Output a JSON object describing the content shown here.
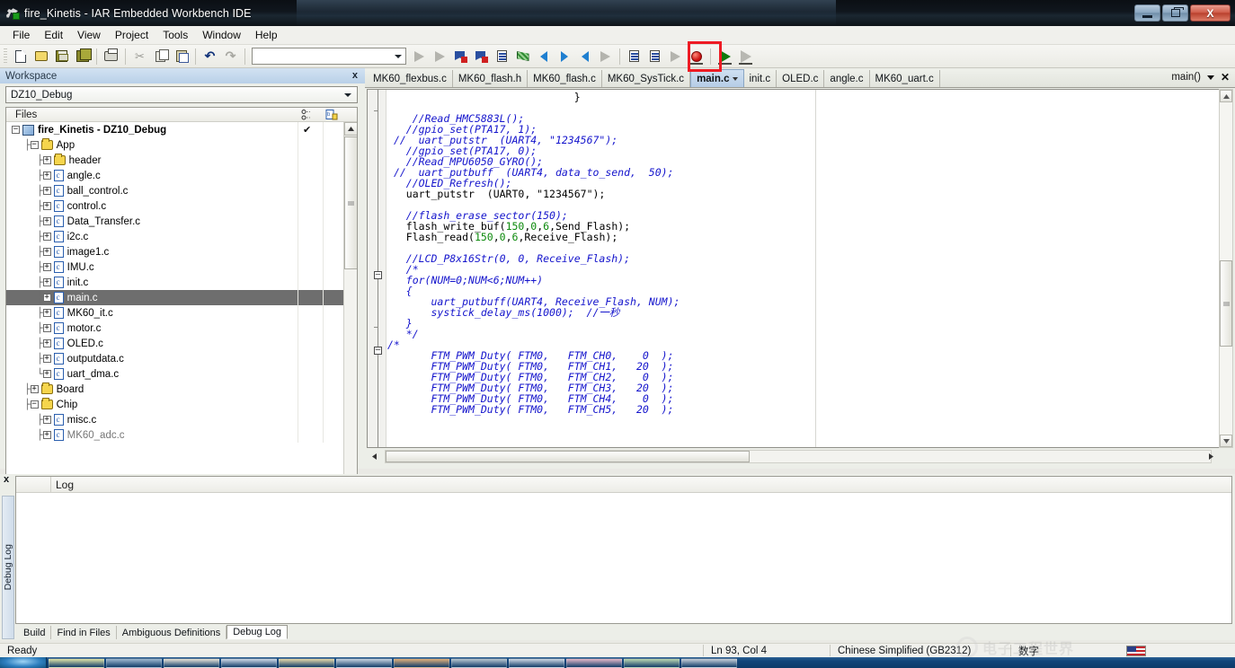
{
  "window": {
    "title": "fire_Kinetis - IAR Embedded Workbench IDE",
    "app_icon": "iar-workbench-icon",
    "buttons": {
      "minimize": "minimize-button",
      "maximize": "maximize-button",
      "close": "X"
    }
  },
  "menu": {
    "items": [
      "File",
      "Edit",
      "View",
      "Project",
      "Tools",
      "Window",
      "Help"
    ]
  },
  "toolbar": {
    "combo_value": "",
    "icons": [
      "new-document-icon",
      "open-folder-icon",
      "save-icon",
      "save-all-icon",
      "print-icon",
      "cut-icon",
      "copy-icon",
      "paste-icon",
      "undo-icon",
      "redo-icon",
      "toggle-bookmark-icon",
      "navigate-bookmark-icon",
      "find-icon",
      "find-next-icon",
      "compile-icon",
      "make-icon",
      "go-back-icon",
      "go-forward-icon",
      "navigate-backward-icon",
      "navigate-forward-icon",
      "stop-build-icon",
      "debug-without-download-icon",
      "toggle-breakpoint-icon",
      "download-and-debug-icon",
      "run-icon"
    ],
    "highlight_color": "#ee1b24",
    "highlighted_button": "download-and-debug-button"
  },
  "workspace": {
    "title": "Workspace",
    "close_label": "x",
    "config_selected": "DZ10_Debug",
    "files_column_header": "Files",
    "tab_label": "fire_Kinetis",
    "tree": [
      {
        "label": "fire_Kinetis - DZ10_Debug",
        "depth": 0,
        "icon": "project-icon",
        "expander": "minus",
        "bold": true,
        "checked": true
      },
      {
        "label": "App",
        "depth": 1,
        "icon": "folder-icon",
        "expander": "minus"
      },
      {
        "label": "header",
        "depth": 2,
        "icon": "folder-icon",
        "expander": "plus"
      },
      {
        "label": "angle.c",
        "depth": 2,
        "icon": "c-file-icon",
        "expander": "plus"
      },
      {
        "label": "ball_control.c",
        "depth": 2,
        "icon": "c-file-icon",
        "expander": "plus"
      },
      {
        "label": "control.c",
        "depth": 2,
        "icon": "c-file-icon",
        "expander": "plus"
      },
      {
        "label": "Data_Transfer.c",
        "depth": 2,
        "icon": "c-file-icon",
        "expander": "plus"
      },
      {
        "label": "i2c.c",
        "depth": 2,
        "icon": "c-file-icon",
        "expander": "plus"
      },
      {
        "label": "image1.c",
        "depth": 2,
        "icon": "c-file-icon",
        "expander": "plus"
      },
      {
        "label": "IMU.c",
        "depth": 2,
        "icon": "c-file-icon",
        "expander": "plus"
      },
      {
        "label": "init.c",
        "depth": 2,
        "icon": "c-file-icon",
        "expander": "plus"
      },
      {
        "label": "main.c",
        "depth": 2,
        "icon": "c-file-icon",
        "expander": "plus",
        "selected": true
      },
      {
        "label": "MK60_it.c",
        "depth": 2,
        "icon": "c-file-icon",
        "expander": "plus"
      },
      {
        "label": "motor.c",
        "depth": 2,
        "icon": "c-file-icon",
        "expander": "plus"
      },
      {
        "label": "OLED.c",
        "depth": 2,
        "icon": "c-file-icon",
        "expander": "plus"
      },
      {
        "label": "outputdata.c",
        "depth": 2,
        "icon": "c-file-icon",
        "expander": "plus"
      },
      {
        "label": "uart_dma.c",
        "depth": 2,
        "icon": "c-file-icon",
        "expander": "plus",
        "last": true
      },
      {
        "label": "Board",
        "depth": 1,
        "icon": "folder-icon",
        "expander": "plus"
      },
      {
        "label": "Chip",
        "depth": 1,
        "icon": "folder-icon",
        "expander": "minus"
      },
      {
        "label": "misc.c",
        "depth": 2,
        "icon": "c-file-icon",
        "expander": "plus"
      },
      {
        "label": "MK60_adc.c",
        "depth": 2,
        "icon": "c-file-icon",
        "expander": "plus",
        "clipped": true
      }
    ]
  },
  "editor": {
    "tabs": [
      {
        "label": "MK60_flexbus.c",
        "active": false
      },
      {
        "label": "MK60_flash.h",
        "active": false
      },
      {
        "label": "MK60_flash.c",
        "active": false
      },
      {
        "label": "MK60_SysTick.c",
        "active": false
      },
      {
        "label": "main.c",
        "active": true
      },
      {
        "label": "init.c",
        "active": false
      },
      {
        "label": "OLED.c",
        "active": false
      },
      {
        "label": "angle.c",
        "active": false
      },
      {
        "label": "MK60_uart.c",
        "active": false
      }
    ],
    "function_selector": "main()",
    "close_label": "✕",
    "lines": [
      {
        "indent": 30,
        "spans": [
          {
            "t": "}",
            "c": "plain"
          }
        ]
      },
      {
        "indent": 0,
        "spans": []
      },
      {
        "indent": 4,
        "spans": [
          {
            "t": "//Read_HMC5883L();",
            "c": "cmt"
          }
        ]
      },
      {
        "indent": 3,
        "spans": [
          {
            "t": "//gpio_set(PTA17, 1);",
            "c": "cmt"
          }
        ]
      },
      {
        "indent": 1,
        "spans": [
          {
            "t": "//  uart_putstr  (UART4, \"1234567\");",
            "c": "cmt"
          }
        ]
      },
      {
        "indent": 3,
        "spans": [
          {
            "t": "//gpio_set(PTA17, 0);",
            "c": "cmt"
          }
        ]
      },
      {
        "indent": 3,
        "spans": [
          {
            "t": "//Read_MPU6050_GYRO();",
            "c": "cmt"
          }
        ]
      },
      {
        "indent": 1,
        "spans": [
          {
            "t": "//  uart_putbuff  (UART4, data_to_send,  50);",
            "c": "cmt"
          }
        ]
      },
      {
        "indent": 3,
        "spans": [
          {
            "t": "//OLED_Refresh();",
            "c": "cmt"
          }
        ]
      },
      {
        "indent": 3,
        "spans": [
          {
            "t": "uart_putstr  (UART0, \"1234567\");",
            "c": "plain"
          }
        ]
      },
      {
        "indent": 0,
        "spans": []
      },
      {
        "indent": 3,
        "spans": [
          {
            "t": "//flash_erase_sector(150);",
            "c": "cmt"
          }
        ]
      },
      {
        "indent": 3,
        "spans": [
          {
            "t": "flash_write_buf(",
            "c": "plain"
          },
          {
            "t": "150",
            "c": "num"
          },
          {
            "t": ",",
            "c": "plain"
          },
          {
            "t": "0",
            "c": "num"
          },
          {
            "t": ",",
            "c": "plain"
          },
          {
            "t": "6",
            "c": "num"
          },
          {
            "t": ",Send_Flash);",
            "c": "plain"
          }
        ]
      },
      {
        "indent": 3,
        "spans": [
          {
            "t": "Flash_read(",
            "c": "plain"
          },
          {
            "t": "150",
            "c": "num"
          },
          {
            "t": ",",
            "c": "plain"
          },
          {
            "t": "0",
            "c": "num"
          },
          {
            "t": ",",
            "c": "plain"
          },
          {
            "t": "6",
            "c": "num"
          },
          {
            "t": ",Receive_Flash);",
            "c": "plain"
          }
        ]
      },
      {
        "indent": 0,
        "spans": []
      },
      {
        "indent": 3,
        "spans": [
          {
            "t": "//LCD_P8x16Str(0, 0, Receive_Flash);",
            "c": "cmt"
          }
        ]
      },
      {
        "indent": 3,
        "spans": [
          {
            "t": "/*",
            "c": "cmt"
          }
        ]
      },
      {
        "indent": 3,
        "spans": [
          {
            "t": "for(NUM=0;NUM<6;NUM++)",
            "c": "cmt"
          }
        ]
      },
      {
        "indent": 3,
        "spans": [
          {
            "t": "{",
            "c": "cmt"
          }
        ]
      },
      {
        "indent": 7,
        "spans": [
          {
            "t": "uart_putbuff(UART4, Receive_Flash, NUM);",
            "c": "cmt"
          }
        ]
      },
      {
        "indent": 7,
        "spans": [
          {
            "t": "systick_delay_ms(1000);  //一秒",
            "c": "cmt"
          }
        ]
      },
      {
        "indent": 3,
        "spans": [
          {
            "t": "}",
            "c": "cmt"
          }
        ]
      },
      {
        "indent": 3,
        "spans": [
          {
            "t": "*/",
            "c": "cmt"
          }
        ]
      },
      {
        "indent": 0,
        "spans": [
          {
            "t": "/*",
            "c": "cmt"
          }
        ]
      },
      {
        "indent": 7,
        "spans": [
          {
            "t": "FTM_PWM_Duty( FTM0,   FTM_CH0,    0  );",
            "c": "cmt"
          }
        ]
      },
      {
        "indent": 7,
        "spans": [
          {
            "t": "FTM_PWM_Duty( FTM0,   FTM_CH1,   20  );",
            "c": "cmt"
          }
        ]
      },
      {
        "indent": 7,
        "spans": [
          {
            "t": "FTM_PWM_Duty( FTM0,   FTM_CH2,    0  );",
            "c": "cmt"
          }
        ]
      },
      {
        "indent": 7,
        "spans": [
          {
            "t": "FTM_PWM_Duty( FTM0,   FTM_CH3,   20  );",
            "c": "cmt"
          }
        ]
      },
      {
        "indent": 7,
        "spans": [
          {
            "t": "FTM_PWM_Duty( FTM0,   FTM_CH4,    0  );",
            "c": "cmt"
          }
        ]
      },
      {
        "indent": 7,
        "spans": [
          {
            "t": "FTM_PWM_Duty( FTM0,   FTM_CH5,   20  );",
            "c": "cmt"
          }
        ]
      }
    ]
  },
  "log": {
    "close_label": "x",
    "vertical_tab_label": "Debug Log",
    "column_header": "Log",
    "rows": [],
    "tabs": [
      {
        "label": "Build",
        "active": false
      },
      {
        "label": "Find in Files",
        "active": false
      },
      {
        "label": "Ambiguous Definitions",
        "active": false
      },
      {
        "label": "Debug Log",
        "active": true
      }
    ]
  },
  "status": {
    "message": "Ready",
    "cursor_position": "Ln 93, Col 4",
    "encoding": "Chinese Simplified (GB2312)",
    "ime_mode": "数字",
    "keyboard_flag": "us-flag-icon"
  },
  "watermark": {
    "text": "电子工程世界"
  },
  "taskbar": {
    "start_label": "start",
    "item_count": 12
  }
}
